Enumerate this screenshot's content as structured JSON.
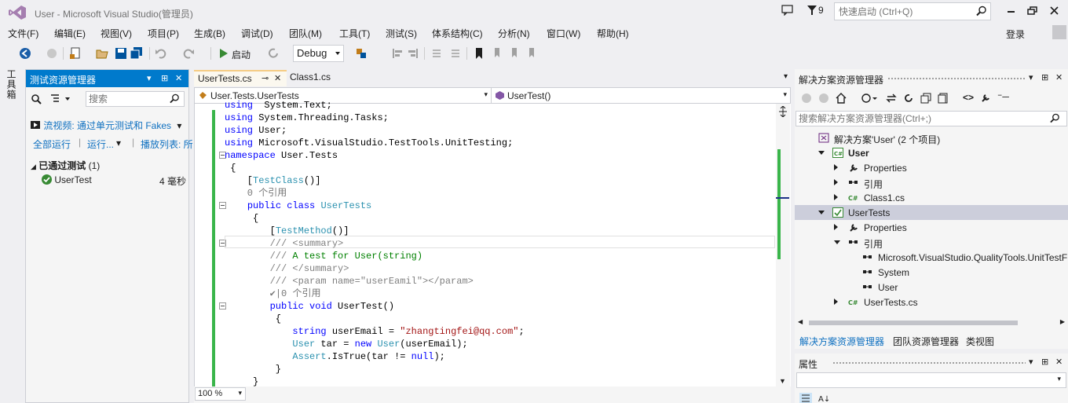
{
  "window": {
    "title": "User - Microsoft Visual Studio(管理员)",
    "notification_count": "9",
    "quick_launch_placeholder": "快速启动 (Ctrl+Q)"
  },
  "menu": [
    "文件(F)",
    "编辑(E)",
    "视图(V)",
    "项目(P)",
    "生成(B)",
    "调试(D)",
    "团队(M)",
    "工具(T)",
    "测试(S)",
    "体系结构(C)",
    "分析(N)",
    "窗口(W)",
    "帮助(H)"
  ],
  "login_label": "登录",
  "toolbar": {
    "start_label": "启动",
    "config": "Debug"
  },
  "toolbox_label": "工具箱",
  "test_explorer": {
    "title": "测试资源管理器",
    "search_placeholder": "搜索",
    "playlist_link": "流视频: 通过单元测试和 Fakes",
    "run_all": "全部运行",
    "run": "运行...",
    "playlist": "播放列表: 所",
    "group_label": "已通过测试",
    "group_count": "(1)",
    "tests": [
      {
        "name": "UserTest",
        "duration": "4 毫秒"
      }
    ]
  },
  "editor": {
    "tabs": [
      {
        "label": "UserTests.cs",
        "active": true
      },
      {
        "label": "Class1.cs",
        "active": false
      }
    ],
    "nav_left": "User.Tests.UserTests",
    "nav_right": "UserTest()",
    "zoom": "100 %",
    "lines": [
      {
        "parts": [
          [
            "kw",
            "using"
          ],
          [
            "",
            "  System.Text;"
          ]
        ]
      },
      {
        "parts": [
          [
            "kw",
            "using"
          ],
          [
            "",
            " System.Threading.Tasks;"
          ]
        ]
      },
      {
        "parts": [
          [
            "kw",
            "using"
          ],
          [
            "",
            " User;"
          ]
        ]
      },
      {
        "parts": [
          [
            "kw",
            "using"
          ],
          [
            "",
            " Microsoft.VisualStudio.TestTools.UnitTesting;"
          ]
        ]
      },
      {
        "parts": [
          [
            "kw",
            "namespace"
          ],
          [
            "",
            " User.Tests"
          ]
        ]
      },
      {
        "parts": [
          [
            "",
            " {"
          ]
        ]
      },
      {
        "parts": [
          [
            "",
            "    ["
          ],
          [
            "ty",
            "TestClass"
          ],
          [
            "",
            "()]"
          ]
        ]
      },
      {
        "parts": [
          [
            "ref",
            "    0 个引用"
          ]
        ]
      },
      {
        "parts": [
          [
            "",
            "    "
          ],
          [
            "kw",
            "public class"
          ],
          [
            "",
            " "
          ],
          [
            "ty",
            "UserTests"
          ]
        ]
      },
      {
        "parts": [
          [
            "",
            "     {"
          ]
        ]
      },
      {
        "parts": [
          [
            "",
            "        ["
          ],
          [
            "ty",
            "TestMethod"
          ],
          [
            "",
            "()]"
          ]
        ]
      },
      {
        "parts": [
          [
            "xml",
            "        ///"
          ],
          [
            "cm",
            " "
          ],
          [
            "xml",
            "<summary>"
          ]
        ]
      },
      {
        "parts": [
          [
            "xml",
            "        ///"
          ],
          [
            "cm",
            " A test for User(string)"
          ]
        ]
      },
      {
        "parts": [
          [
            "xml",
            "        ///"
          ],
          [
            "cm",
            " "
          ],
          [
            "xml",
            "</summary>"
          ]
        ]
      },
      {
        "parts": [
          [
            "xml",
            "        ///"
          ],
          [
            "cm",
            " "
          ],
          [
            "xml",
            "<param name=\"userEamil\"></param>"
          ]
        ]
      },
      {
        "parts": [
          [
            "ref",
            "        ✔|0 个引用"
          ]
        ]
      },
      {
        "parts": [
          [
            "",
            "        "
          ],
          [
            "kw",
            "public void"
          ],
          [
            "",
            " UserTest()"
          ]
        ]
      },
      {
        "parts": [
          [
            "",
            "         {"
          ]
        ]
      },
      {
        "parts": [
          [
            "",
            "            "
          ],
          [
            "kw",
            "string"
          ],
          [
            "",
            " userEmail = "
          ],
          [
            "st",
            "\"zhangtingfei@qq.com\""
          ],
          [
            "",
            ";"
          ]
        ]
      },
      {
        "parts": [
          [
            "",
            "            "
          ],
          [
            "ty",
            "User"
          ],
          [
            "",
            " tar = "
          ],
          [
            "kw",
            "new"
          ],
          [
            "",
            " "
          ],
          [
            "ty",
            "User"
          ],
          [
            "",
            "(userEmail);"
          ]
        ]
      },
      {
        "parts": [
          [
            "",
            "            "
          ],
          [
            "ty",
            "Assert"
          ],
          [
            "",
            ".IsTrue(tar != "
          ],
          [
            "kw",
            "null"
          ],
          [
            "",
            ");"
          ]
        ]
      },
      {
        "parts": [
          [
            "",
            "         }"
          ]
        ]
      },
      {
        "parts": [
          [
            "",
            "     }"
          ]
        ]
      }
    ]
  },
  "solution_explorer": {
    "title": "解决方案资源管理器",
    "search_placeholder": "搜索解决方案资源管理器(Ctrl+;)",
    "tree": [
      {
        "label": "解决方案'User' (2 个项目)",
        "icon": "solution-icon",
        "indent": 0,
        "expander": "none",
        "bold": false
      },
      {
        "label": "User",
        "icon": "csharp-project-icon",
        "indent": 1,
        "expander": "open",
        "bold": true
      },
      {
        "label": "Properties",
        "icon": "wrench-icon",
        "indent": 2,
        "expander": "closed",
        "bold": false
      },
      {
        "label": "引用",
        "icon": "references-icon",
        "indent": 2,
        "expander": "closed",
        "bold": false
      },
      {
        "label": "Class1.cs",
        "icon": "csharp-file-icon",
        "indent": 2,
        "expander": "closed",
        "bold": false
      },
      {
        "label": "UserTests",
        "icon": "test-project-icon",
        "indent": 1,
        "expander": "open",
        "bold": false,
        "selected": true
      },
      {
        "label": "Properties",
        "icon": "wrench-icon",
        "indent": 2,
        "expander": "closed",
        "bold": false
      },
      {
        "label": "引用",
        "icon": "references-icon",
        "indent": 2,
        "expander": "open",
        "bold": false
      },
      {
        "label": "Microsoft.VisualStudio.QualityTools.UnitTestFramework",
        "icon": "reference-icon",
        "indent": 3,
        "expander": "none",
        "bold": false
      },
      {
        "label": "System",
        "icon": "reference-icon",
        "indent": 3,
        "expander": "none",
        "bold": false
      },
      {
        "label": "User",
        "icon": "reference-icon",
        "indent": 3,
        "expander": "none",
        "bold": false
      },
      {
        "label": "UserTests.cs",
        "icon": "csharp-file-icon",
        "indent": 2,
        "expander": "closed",
        "bold": false
      }
    ],
    "bottom_tabs": [
      "解决方案资源管理器",
      "团队资源管理器",
      "类视图"
    ]
  },
  "properties": {
    "title": "属性"
  },
  "colors": {
    "accent": "#007acc",
    "change_bar": "#39b54a",
    "keyword": "#0000ff",
    "type": "#2b91af",
    "comment": "#008000",
    "string": "#a31515"
  }
}
